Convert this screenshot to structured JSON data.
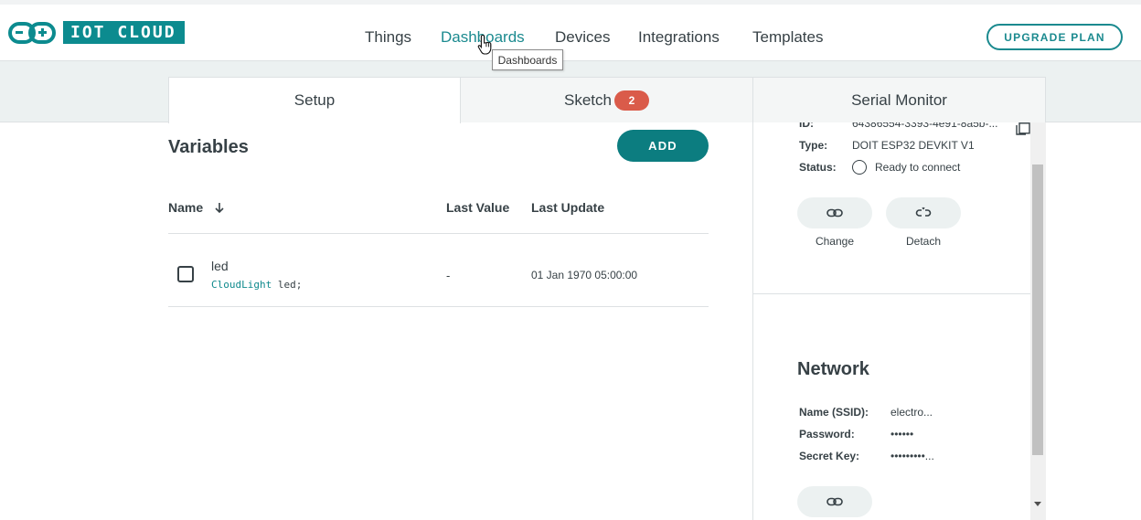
{
  "app": {
    "logo_text": "IOT CLOUD",
    "nav": [
      {
        "label": "Things"
      },
      {
        "label": "Dashboards"
      },
      {
        "label": "Devices"
      },
      {
        "label": "Integrations"
      },
      {
        "label": "Templates"
      }
    ],
    "active_nav": "Dashboards",
    "upgrade_label": "UPGRADE PLAN",
    "tooltip": "Dashboards",
    "accent_color": "#0c8b8f"
  },
  "tabs": [
    {
      "label": "Setup"
    },
    {
      "label": "Sketch",
      "badge": "2"
    },
    {
      "label": "Serial Monitor"
    }
  ],
  "variables": {
    "title": "Variables",
    "add_label": "ADD",
    "columns": {
      "name": "Name",
      "last_value": "Last Value",
      "last_update": "Last Update"
    },
    "rows": [
      {
        "name": "led",
        "type": "CloudLight",
        "decl": " led;",
        "last_value": "-",
        "last_update": "01 Jan 1970 05:00:00"
      }
    ]
  },
  "device": {
    "id_label": "ID:",
    "id_value": "64386554-3393-4e91-8a5b-...",
    "type_label": "Type:",
    "type_value": "DOIT ESP32 DEVKIT V1",
    "status_label": "Status:",
    "status_value": "Ready to connect",
    "change_label": "Change",
    "detach_label": "Detach"
  },
  "network": {
    "title": "Network",
    "ssid_label": "Name (SSID):",
    "ssid_value": "electro...",
    "password_label": "Password:",
    "password_value": "••••••",
    "secret_label": "Secret Key:",
    "secret_value": "•••••••••..."
  }
}
